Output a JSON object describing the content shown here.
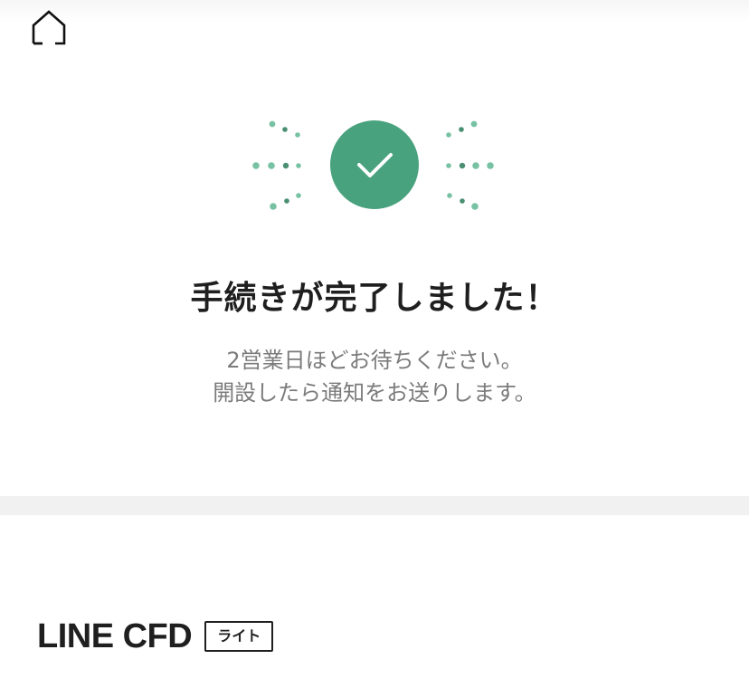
{
  "header": {
    "home_icon": "home-icon"
  },
  "status": {
    "icon": "check-icon",
    "accent_color": "#49a27e",
    "dot_color": "#78c2a4",
    "title": "手続きが完了しました！",
    "message_lines": [
      "2営業日ほどお待ちください。",
      "開設したら通知をお送りします。"
    ]
  },
  "product": {
    "name": "LINE CFD",
    "badge": "ライト"
  }
}
